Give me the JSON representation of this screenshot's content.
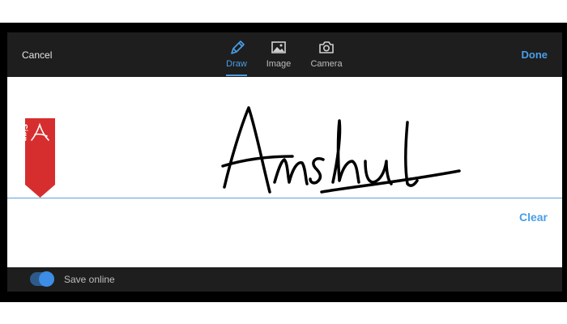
{
  "header": {
    "cancel_label": "Cancel",
    "done_label": "Done",
    "tabs": [
      {
        "label": "Draw",
        "icon": "pen-icon",
        "active": true
      },
      {
        "label": "Image",
        "icon": "image-icon",
        "active": false
      },
      {
        "label": "Camera",
        "icon": "camera-icon",
        "active": false
      }
    ]
  },
  "canvas": {
    "sign_tag_label": "Sign",
    "signature_text": "Anshul",
    "clear_label": "Clear"
  },
  "footer": {
    "save_online_label": "Save online",
    "save_online_enabled": true
  },
  "colors": {
    "accent": "#4a9ee8",
    "toolbar": "#1e1e1e",
    "sign_tag": "#d62e2e"
  }
}
